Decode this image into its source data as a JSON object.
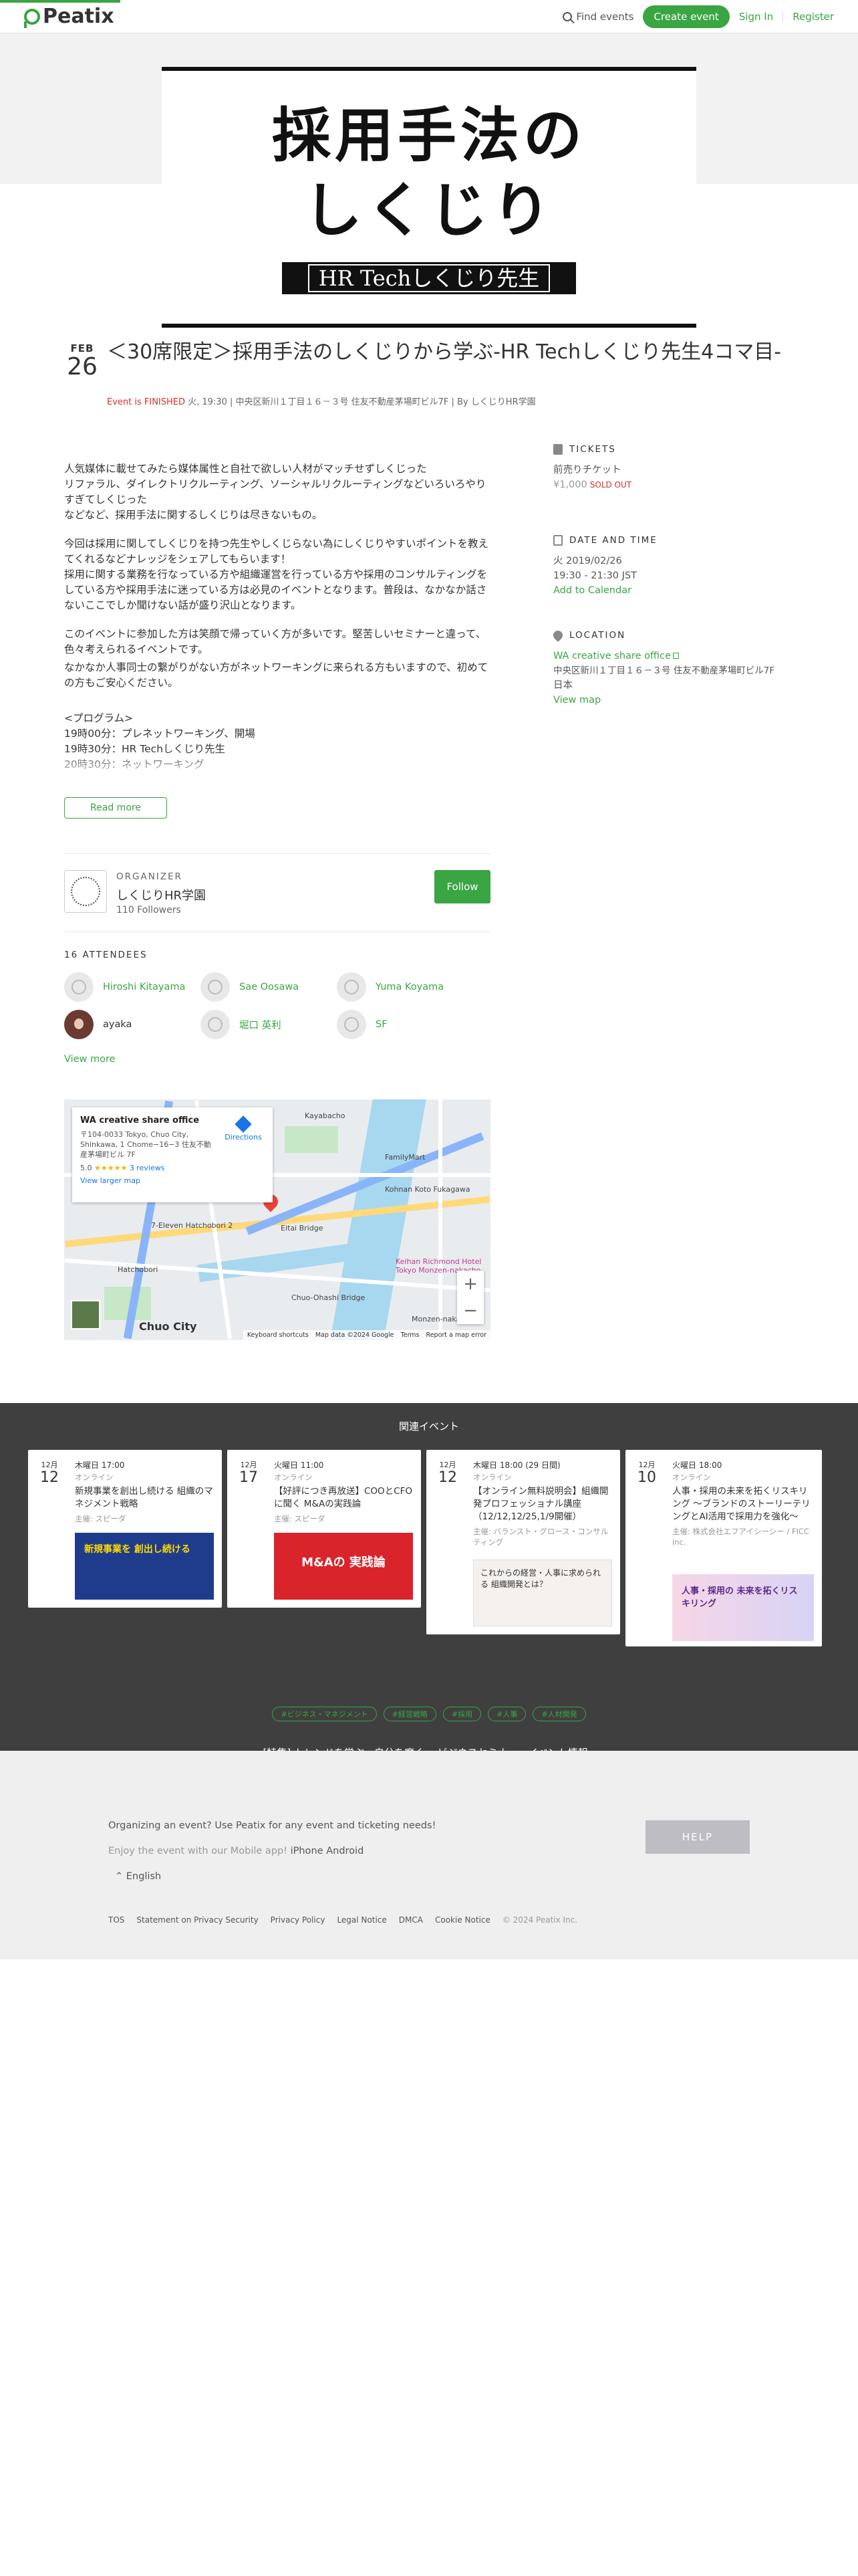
{
  "header": {
    "logo_text": "Peatix",
    "find_events": "Find events",
    "create_event": "Create event",
    "sign_in": "Sign In",
    "register": "Register"
  },
  "hero": {
    "title_line1": "採用手法の",
    "title_line2": "しくじり",
    "banner": "HR Techしくじり先生"
  },
  "event": {
    "month": "FEB",
    "day": "26",
    "title": "＜30席限定＞採用手法のしくじりから学ぶ-HR Techしくじり先生4コマ目-",
    "status": "Event is FINISHED",
    "meta": " 火, 19:30 | 中央区新川１丁目１６－３号 住友不動産茅場町ビル7F | By しくじりHR学園"
  },
  "description": {
    "p1": "人気媒体に載せてみたら媒体属性と自社で欲しい人材がマッチせずしくじった\nリファラル、ダイレクトリクルーティング、ソーシャルリクルーティングなどいろいろやりすぎてしくじった\nなどなど、採用手法に関するしくじりは尽きないもの。",
    "p2": "今回は採用に関してしくじりを持つ先生やしくじらない為にしくじりやすいポイントを教えてくれるなどナレッジをシェアしてもらいます！\n採用に関する業務を行なっている方や組織運営を行っている方や採用のコンサルティングをしている方や採用手法に迷っている方は必見のイベントとなります。普段は、なかなか話さないここでしか聞けない話が盛り沢山となります。",
    "p3": "このイベントに参加した方は笑顔で帰っていく方が多いです。堅苦しいセミナーと違って、色々考えられるイベントです。",
    "p4": "なかなか人事同士の繋がりがない方がネットワーキングに来られる方もいますので、初めての方もご安心ください。",
    "p5": "<プログラム>\n19時00分：プレネットワーキング、開場\n19時30分：HR Techしくじり先生\n20時30分：ネットワーキング",
    "read_more": "Read more"
  },
  "tickets": {
    "heading": "TICKETS",
    "name": "前売りチケット",
    "price": "¥1,000",
    "sold_out": "SOLD OUT"
  },
  "datetime": {
    "heading": "DATE AND TIME",
    "date": "火 2019/02/26",
    "time": "19:30 - 21:30 JST",
    "add_calendar": "Add to Calendar"
  },
  "location": {
    "heading": "LOCATION",
    "venue": "WA creative share office",
    "address": "中央区新川１丁目１６－３号 住友不動産茅場町ビル7F",
    "country": "日本",
    "view_map": "View map"
  },
  "organizer": {
    "label": "ORGANIZER",
    "name": "しくじりHR学園",
    "followers": "110 Followers",
    "follow": "Follow"
  },
  "attendees": {
    "title": "16 ATTENDEES",
    "list": [
      "Hiroshi Kitayama",
      "Sae Oosawa",
      "Yuma Koyama",
      "ayaka",
      "堀口 英利",
      "SF"
    ],
    "view_more": "View more"
  },
  "map": {
    "card_title": "WA creative share office",
    "card_addr": "〒104-0033 Tokyo, Chuo City, Shinkawa, 1 Chome−16−3 住友不動産茅場町ビル 7F",
    "rating": "5.0",
    "stars": "★★★★★",
    "reviews": "3 reviews",
    "larger": "View larger map",
    "directions": "Directions",
    "labels": {
      "hatchobori": "Hatchobori",
      "chuo_city": "Chuo City",
      "kayabacho": "Kayabacho",
      "eitai": "Eitai Bridge",
      "monzen": "Monzen-nakacho",
      "richmond": "Keihan Richmond Hotel Tokyo Monzen-nakacho",
      "familymart": "FamilyMart",
      "seven": "7-Eleven Hatchobori 2",
      "kohnan": "Kohnan Koto Fukagawa",
      "chuo_ohashi": "Chuo-Ohashi Bridge"
    },
    "zoom_in": "+",
    "zoom_out": "−",
    "footer": [
      "Keyboard shortcuts",
      "Map data ©2024 Google",
      "Terms",
      "Report a map error"
    ]
  },
  "related": {
    "title": "関連イベント",
    "cards": [
      {
        "month": "12月",
        "day": "12",
        "time": "木曜日 17:00",
        "online": "オンライン",
        "title": "新規事業を創出し続ける 組織のマネジメント戦略",
        "host": "主催: スピーダ",
        "img_text": "新規事業を 創出し続ける"
      },
      {
        "month": "12月",
        "day": "17",
        "time": "火曜日 11:00",
        "online": "オンライン",
        "title": "【好評につき再放送】COOとCFOに聞く M&Aの実践論",
        "host": "主催: スピーダ",
        "img_text": "M&Aの 実践論"
      },
      {
        "month": "12月",
        "day": "12",
        "time": "木曜日 18:00 (29 日間)",
        "online": "オンライン",
        "title": "【オンライン無料説明会】組織開発プロフェッショナル講座（12/12,12/25,1/9開催）",
        "host": "主催: バランスト・グロース・コンサルティング",
        "img_text": "これからの経営・人事に求められる 組織開発とは？"
      },
      {
        "month": "12月",
        "day": "10",
        "time": "火曜日 18:00",
        "online": "オンライン",
        "title": "人事・採用の未来を拓くリスキリング ～ブランドのストーリーテリングとAI活用で採用力を強化～",
        "host": "主催: 株式会社エフアイシーシー / FICC inc.",
        "img_text": "人事・採用の 未来を拓くリスキリング"
      }
    ],
    "tags": [
      "#ビジネス・マネジメント",
      "#経営戦略",
      "#採用",
      "#人事",
      "#人材開発"
    ],
    "special": "[特集] トレンドを学ぶ、自分を磨く。 ビジネスセミナー・イベント情報"
  },
  "footer": {
    "question": "Organizing an event? Use Peatix for any event and ticketing needs!",
    "app_prefix": "Enjoy the event with our Mobile app!",
    "iphone": "iPhone",
    "android": "Android",
    "language": "English",
    "help": "HELP",
    "links": [
      "TOS",
      "Statement on Privacy Security",
      "Privacy Policy",
      "Legal Notice",
      "DMCA",
      "Cookie Notice"
    ],
    "copyright": "© 2024 Peatix Inc."
  }
}
